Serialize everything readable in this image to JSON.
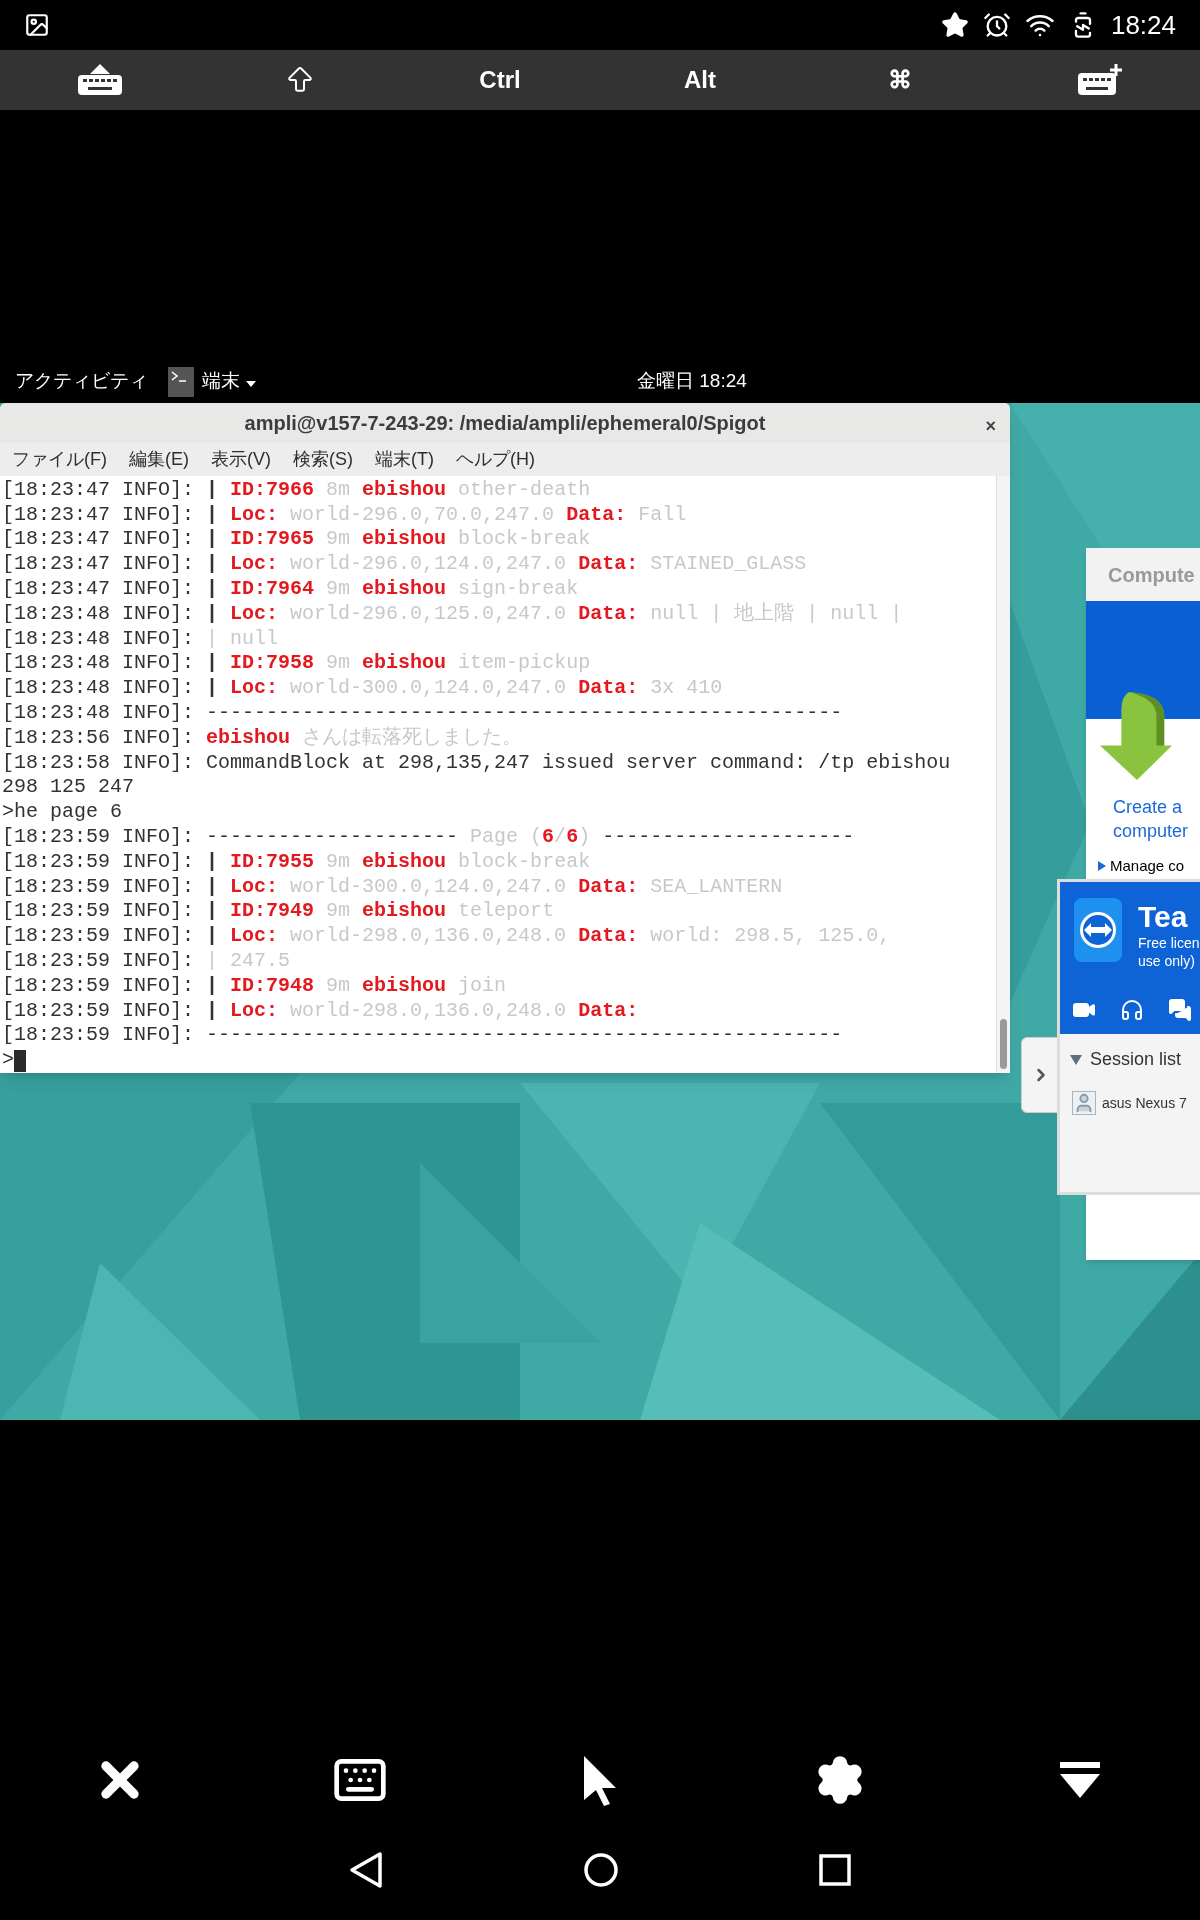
{
  "status_bar": {
    "time": "18:24"
  },
  "key_toolbar": {
    "keys": [
      {
        "kind": "hide_keyboard"
      },
      {
        "kind": "shift"
      },
      {
        "kind": "label",
        "label": "Ctrl"
      },
      {
        "kind": "label",
        "label": "Alt"
      },
      {
        "kind": "label",
        "label": "⌘"
      },
      {
        "kind": "add_keyboard"
      }
    ]
  },
  "top_bar": {
    "activities": "アクティビティ",
    "app_menu": "端末",
    "clock": "金曜日 18:24"
  },
  "terminal": {
    "title": "ampli@v157-7-243-29: /media/ampli/ephemeral0/Spigot",
    "close": "×",
    "menu": [
      "ファイル(F)",
      "編集(E)",
      "表示(V)",
      "検索(S)",
      "端末(T)",
      "ヘルプ(H)"
    ],
    "cursor": true,
    "lines": [
      [
        {
          "kind": "plain",
          "text": "[18:23:47 INFO]: "
        },
        {
          "kind": "bold",
          "text": "| "
        },
        {
          "kind": "red",
          "text": "ID:7966"
        },
        {
          "kind": "dim",
          "text": " 8m "
        },
        {
          "kind": "red",
          "text": "ebishou"
        },
        {
          "kind": "dim",
          "text": " other-death"
        }
      ],
      [
        {
          "kind": "plain",
          "text": "[18:23:47 INFO]: "
        },
        {
          "kind": "bold",
          "text": "| "
        },
        {
          "kind": "red",
          "text": "Loc:"
        },
        {
          "kind": "dim",
          "text": " world-296.0,70.0,247.0 "
        },
        {
          "kind": "red",
          "text": "Data:"
        },
        {
          "kind": "dim",
          "text": " Fall"
        }
      ],
      [
        {
          "kind": "plain",
          "text": "[18:23:47 INFO]: "
        },
        {
          "kind": "bold",
          "text": "| "
        },
        {
          "kind": "red",
          "text": "ID:7965"
        },
        {
          "kind": "dim",
          "text": " 9m "
        },
        {
          "kind": "red",
          "text": "ebishou"
        },
        {
          "kind": "dim",
          "text": " block-break"
        }
      ],
      [
        {
          "kind": "plain",
          "text": "[18:23:47 INFO]: "
        },
        {
          "kind": "bold",
          "text": "| "
        },
        {
          "kind": "red",
          "text": "Loc:"
        },
        {
          "kind": "dim",
          "text": " world-296.0,124.0,247.0 "
        },
        {
          "kind": "red",
          "text": "Data:"
        },
        {
          "kind": "dim",
          "text": " STAINED_GLASS"
        }
      ],
      [
        {
          "kind": "plain",
          "text": "[18:23:47 INFO]: "
        },
        {
          "kind": "bold",
          "text": "| "
        },
        {
          "kind": "red",
          "text": "ID:7964"
        },
        {
          "kind": "dim",
          "text": " 9m "
        },
        {
          "kind": "red",
          "text": "ebishou"
        },
        {
          "kind": "dim",
          "text": " sign-break"
        }
      ],
      [
        {
          "kind": "plain",
          "text": "[18:23:48 INFO]: "
        },
        {
          "kind": "bold",
          "text": "| "
        },
        {
          "kind": "red",
          "text": "Loc:"
        },
        {
          "kind": "dim",
          "text": " world-296.0,125.0,247.0 "
        },
        {
          "kind": "red",
          "text": "Data:"
        },
        {
          "kind": "dim",
          "text": " null | 地上階 | null |"
        }
      ],
      [
        {
          "kind": "plain",
          "text": "[18:23:48 INFO]: "
        },
        {
          "kind": "dim",
          "text": "| null"
        }
      ],
      [
        {
          "kind": "plain",
          "text": "[18:23:48 INFO]: "
        },
        {
          "kind": "bold",
          "text": "| "
        },
        {
          "kind": "red",
          "text": "ID:7958"
        },
        {
          "kind": "dim",
          "text": " 9m "
        },
        {
          "kind": "red",
          "text": "ebishou"
        },
        {
          "kind": "dim",
          "text": " item-pickup"
        }
      ],
      [
        {
          "kind": "plain",
          "text": "[18:23:48 INFO]: "
        },
        {
          "kind": "bold",
          "text": "| "
        },
        {
          "kind": "red",
          "text": "Loc:"
        },
        {
          "kind": "dim",
          "text": " world-300.0,124.0,247.0 "
        },
        {
          "kind": "red",
          "text": "Data:"
        },
        {
          "kind": "dim",
          "text": " 3x 410"
        }
      ],
      [
        {
          "kind": "plain",
          "text": "[18:23:48 INFO]: -----------------------------------------------------"
        }
      ],
      [
        {
          "kind": "plain",
          "text": "[18:23:56 INFO]: "
        },
        {
          "kind": "red",
          "text": "ebishou"
        },
        {
          "kind": "dim",
          "text": " さんは転落死しました。"
        }
      ],
      [
        {
          "kind": "plain",
          "text": "[18:23:58 INFO]: CommandBlock at 298,135,247 issued server command: /tp ebishou"
        }
      ],
      [
        {
          "kind": "plain",
          "text": "298 125 247"
        }
      ],
      [
        {
          "kind": "plain",
          "text": ">he page 6"
        }
      ],
      [
        {
          "kind": "plain",
          "text": "[18:23:59 INFO]: ---------------------"
        },
        {
          "kind": "dim",
          "text": " Page ("
        },
        {
          "kind": "red",
          "text": "6"
        },
        {
          "kind": "dim",
          "text": "/"
        },
        {
          "kind": "red",
          "text": "6"
        },
        {
          "kind": "dim",
          "text": ") "
        },
        {
          "kind": "plain",
          "text": "---------------------"
        }
      ],
      [
        {
          "kind": "plain",
          "text": "[18:23:59 INFO]: "
        },
        {
          "kind": "bold",
          "text": "| "
        },
        {
          "kind": "red",
          "text": "ID:7955"
        },
        {
          "kind": "dim",
          "text": " 9m "
        },
        {
          "kind": "red",
          "text": "ebishou"
        },
        {
          "kind": "dim",
          "text": " block-break"
        }
      ],
      [
        {
          "kind": "plain",
          "text": "[18:23:59 INFO]: "
        },
        {
          "kind": "bold",
          "text": "| "
        },
        {
          "kind": "red",
          "text": "Loc:"
        },
        {
          "kind": "dim",
          "text": " world-300.0,124.0,247.0 "
        },
        {
          "kind": "red",
          "text": "Data:"
        },
        {
          "kind": "dim",
          "text": " SEA_LANTERN"
        }
      ],
      [
        {
          "kind": "plain",
          "text": "[18:23:59 INFO]: "
        },
        {
          "kind": "bold",
          "text": "| "
        },
        {
          "kind": "red",
          "text": "ID:7949"
        },
        {
          "kind": "dim",
          "text": " 9m "
        },
        {
          "kind": "red",
          "text": "ebishou"
        },
        {
          "kind": "dim",
          "text": " teleport"
        }
      ],
      [
        {
          "kind": "plain",
          "text": "[18:23:59 INFO]: "
        },
        {
          "kind": "bold",
          "text": "| "
        },
        {
          "kind": "red",
          "text": "Loc:"
        },
        {
          "kind": "dim",
          "text": " world-298.0,136.0,248.0 "
        },
        {
          "kind": "red",
          "text": "Data:"
        },
        {
          "kind": "dim",
          "text": " world: 298.5, 125.0,"
        }
      ],
      [
        {
          "kind": "plain",
          "text": "[18:23:59 INFO]: "
        },
        {
          "kind": "dim",
          "text": "| 247.5"
        }
      ],
      [
        {
          "kind": "plain",
          "text": "[18:23:59 INFO]: "
        },
        {
          "kind": "bold",
          "text": "| "
        },
        {
          "kind": "red",
          "text": "ID:7948"
        },
        {
          "kind": "dim",
          "text": " 9m "
        },
        {
          "kind": "red",
          "text": "ebishou"
        },
        {
          "kind": "dim",
          "text": " join"
        }
      ],
      [
        {
          "kind": "plain",
          "text": "[18:23:59 INFO]: "
        },
        {
          "kind": "bold",
          "text": "| "
        },
        {
          "kind": "red",
          "text": "Loc:"
        },
        {
          "kind": "dim",
          "text": " world-298.0,136.0,248.0 "
        },
        {
          "kind": "red",
          "text": "Data:"
        }
      ],
      [
        {
          "kind": "plain",
          "text": "[18:23:59 INFO]: -----------------------------------------------------"
        }
      ],
      [
        {
          "kind": "plain",
          "text": ">"
        }
      ]
    ]
  },
  "computers_panel": {
    "header": "Compute",
    "link_lines": [
      "Create a",
      "computer"
    ],
    "manage": "Manage co"
  },
  "teamviewer": {
    "title": "Tea",
    "subtitle_lines": [
      "Free licen",
      "use only)"
    ],
    "section": "Session list",
    "sessions": [
      "asus Nexus 7"
    ]
  }
}
